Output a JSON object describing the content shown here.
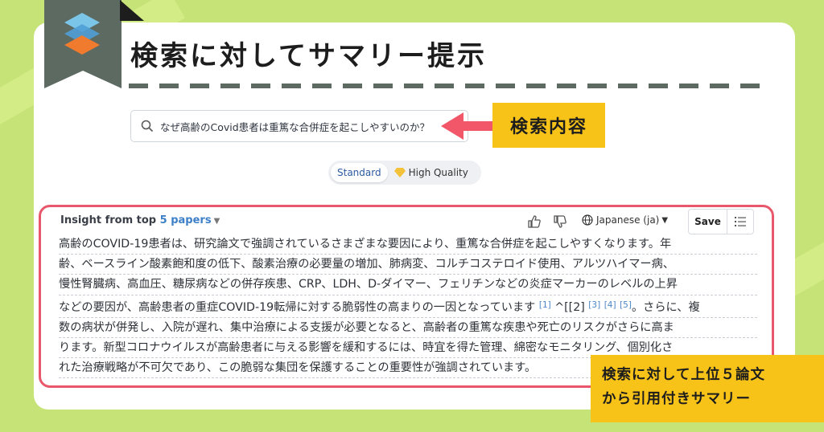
{
  "heading": "検索に対してサマリー提示",
  "search": {
    "query": "なぜ高齢のCovid患者は重篤な合併症を起こしやすいのか？"
  },
  "callouts": {
    "search_label": "検索内容",
    "summary_line1": "検索に対して上位５論文",
    "summary_line2": "から引用付きサマリー"
  },
  "toggle": {
    "standard": "Standard",
    "high_quality": "High Quality"
  },
  "insight": {
    "header_prefix": "Insight from top",
    "papers_link": "5 papers",
    "language": "Japanese (ja)",
    "save": "Save",
    "lines": [
      "高齢のCOVID-19患者は、研究論文で強調されているさまざまな要因により、重篤な合併症を起こしやすくなります。年",
      "齢、ベースライン酸素飽和度の低下、酸素治療の必要量の増加、肺病変、コルチコステロイド使用、アルツハイマー病、",
      "慢性腎臓病、高血圧、糖尿病などの併存疾患、CRP、LDH、D-ダイマー、フェリチンなどの炎症マーカーのレベルの上昇",
      "などの要因が、高齢患者の重症COVID-19転帰に対する脆弱性の高まりの一因となっています",
      "数の病状が併発し、入院が遅れ、集中治療による支援が必要となると、高齢者の重篤な疾患や死亡のリスクがさらに高ま",
      "ります。新型コロナウイルスが高齢患者に与える影響を緩和するには、時宜を得た管理、綿密なモニタリング、個別化さ",
      "れた治療戦略が不可欠であり、この脆弱な集団を保護することの重要性が強調されています。"
    ],
    "cite1": "[1]",
    "mid_text": "^[[2]",
    "cite3": "[3]",
    "cite4": "[4]",
    "cite5": "[5]",
    "line4_tail": "。さらに、複"
  },
  "colors": {
    "background": "#c6e377",
    "bookmark": "#5d6a62",
    "callout": "#f8c318",
    "highlight_border": "#e8586a",
    "arrow": "#f25769",
    "link": "#3d7fc8"
  }
}
